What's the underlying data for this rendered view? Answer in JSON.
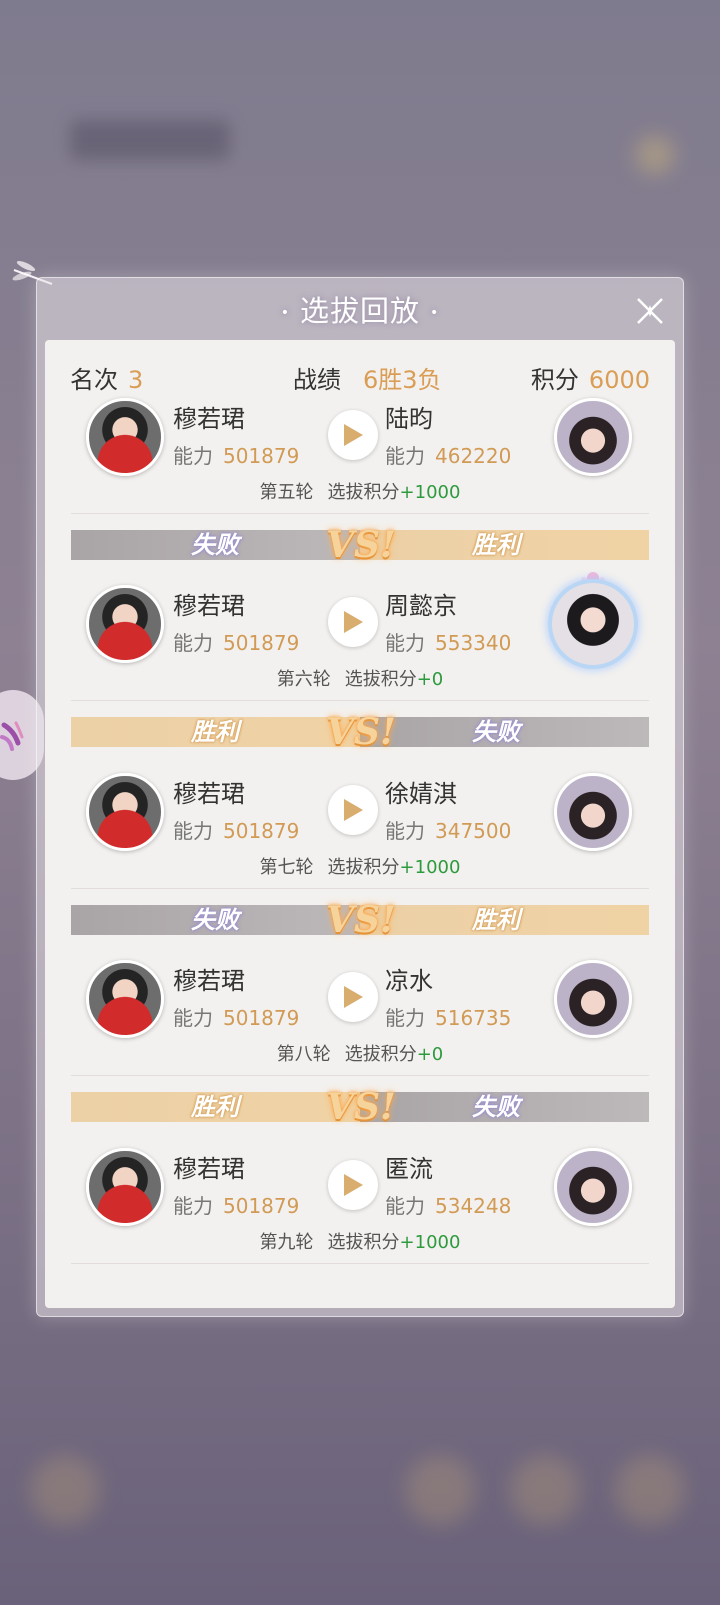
{
  "title": "选拔回放",
  "stats": {
    "rank_label": "名次",
    "rank_value": "3",
    "record_label": "战绩",
    "record_value": "6胜3负",
    "score_label": "积分",
    "score_value": "6000"
  },
  "labels": {
    "power": "能力",
    "score_gain": "选拔积分"
  },
  "player": {
    "name": "穆若珺",
    "power": "501879"
  },
  "matches": [
    {
      "round": "第五轮",
      "opponent": "陆昀",
      "opp_power": "462220",
      "gain": "+1000"
    },
    {
      "round": "第六轮",
      "opponent": "周懿京",
      "opp_power": "553340",
      "gain": "+0"
    },
    {
      "round": "第七轮",
      "opponent": "徐婧淇",
      "opp_power": "347500",
      "gain": "+1000"
    },
    {
      "round": "第八轮",
      "opponent": "凉水",
      "opp_power": "516735",
      "gain": "+0"
    },
    {
      "round": "第九轮",
      "opponent": "匿流",
      "opp_power": "534248",
      "gain": "+1000"
    }
  ],
  "results": {
    "win": "胜利",
    "fail": "失败",
    "vs": "VS!"
  },
  "icons": {
    "close": "close-x-icon",
    "play": "play-icon",
    "dragonfly": "dragonfly-icon",
    "side": "side-menu-icon"
  },
  "colors": {
    "gold": "#d19a55",
    "green": "#2e9a3e",
    "win_bar": "#f0d3a5",
    "fail_bar": "#bdb8b9"
  }
}
